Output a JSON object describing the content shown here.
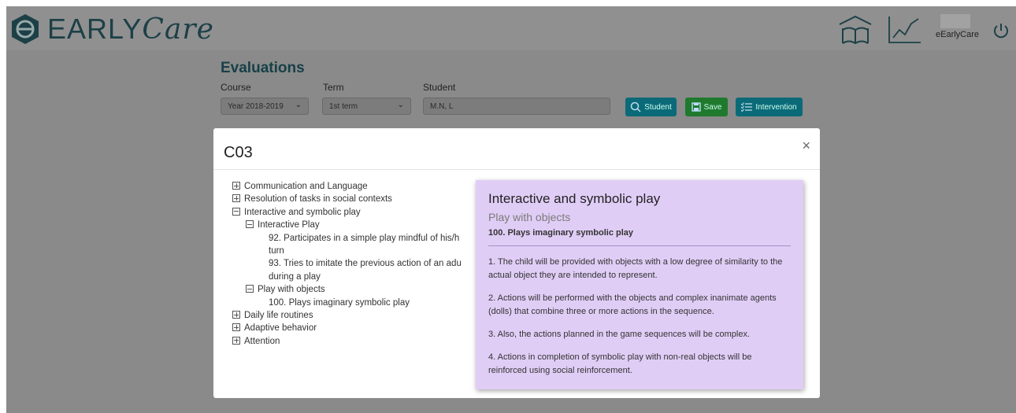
{
  "app": {
    "logo_text": "EARLY",
    "logo_text_script": "Care"
  },
  "header": {
    "user_name": "eEarlyCare"
  },
  "form": {
    "title": "Evaluations",
    "course_label": "Course",
    "course_value": "Year 2018-2019",
    "term_label": "Term",
    "term_value": "1st term",
    "student_label": "Student",
    "student_value": "M.N, L",
    "student_button": "Student",
    "save_button": "Save",
    "intervention_button": "Intervention"
  },
  "colors": {
    "brand": "#1d4047",
    "student_button": "#0b6a78",
    "save_button": "#1f7a2e",
    "intervention_button": "#0b6a78",
    "card_bg": "#e0cdf6"
  },
  "modal": {
    "title": "C03",
    "close": "×",
    "tree": [
      {
        "label": "Communication and Language",
        "state": "collapsed"
      },
      {
        "label": "Resolution of tasks in social contexts",
        "state": "collapsed"
      },
      {
        "label": "Interactive and symbolic play",
        "state": "expanded"
      },
      {
        "label": "Interactive Play",
        "state": "expanded"
      },
      {
        "label": "92. Participates in a simple play mindful of his/h",
        "cont": "turn"
      },
      {
        "label": "93. Tries to imitate the previous action of an adu",
        "cont": "during a play"
      },
      {
        "label": "Play with objects",
        "state": "expanded"
      },
      {
        "label": "100. Plays imaginary symbolic play"
      },
      {
        "label": "Daily life routines",
        "state": "collapsed"
      },
      {
        "label": "Adaptive behavior",
        "state": "collapsed"
      },
      {
        "label": "Attention",
        "state": "collapsed"
      }
    ],
    "card": {
      "title": "Interactive and symbolic play",
      "subtitle": "Play with objects",
      "item": "100. Plays imaginary symbolic play",
      "paragraphs": [
        "1. The child will be provided with objects with a low degree of similarity to the actual object they are intended to represent.",
        "2. Actions will be performed with the objects and complex inanimate agents (dolls) that combine three or more actions in the sequence.",
        "3. Also, the actions planned in the game sequences will be complex.",
        "4. Actions in completion of symbolic play with non-real objects will be reinforced using social reinforcement."
      ]
    }
  }
}
